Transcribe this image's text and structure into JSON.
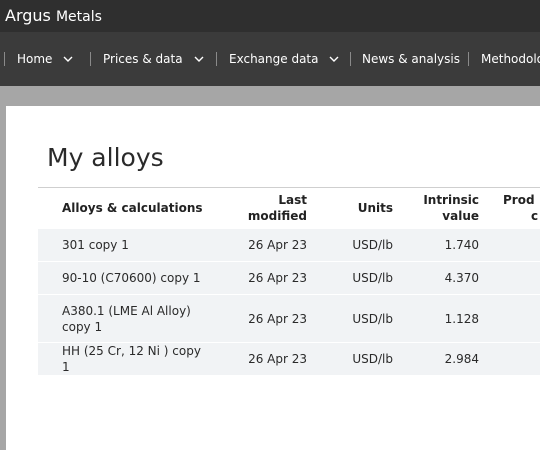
{
  "brand": {
    "part1": "Argus",
    "part2": "Metals"
  },
  "nav": [
    {
      "label": "Home",
      "has_menu": true
    },
    {
      "label": "Prices & data",
      "has_menu": true
    },
    {
      "label": "Exchange data",
      "has_menu": true
    },
    {
      "label": "News & analysis",
      "has_menu": false
    },
    {
      "label": "Methodolog",
      "has_menu": false
    }
  ],
  "page": {
    "title": "My alloys"
  },
  "table": {
    "headers": {
      "name": "Alloys & calculations",
      "modified_line1": "Last",
      "modified_line2": "modified",
      "units": "Units",
      "value_line1": "Intrinsic",
      "value_line2": "value",
      "prod_line1": "Prod",
      "prod_line2": "c"
    },
    "rows": [
      {
        "name": "301 copy 1",
        "modified": "26 Apr 23",
        "units": "USD/lb",
        "value": "1.740"
      },
      {
        "name": "90-10 (C70600) copy 1",
        "modified": "26 Apr 23",
        "units": "USD/lb",
        "value": "4.370"
      },
      {
        "name": "A380.1 (LME Al Alloy) copy 1",
        "modified": "26 Apr 23",
        "units": "USD/lb",
        "value": "1.128"
      },
      {
        "name": "HH (25 Cr, 12 Ni ) copy 1",
        "modified": "26 Apr 23",
        "units": "USD/lb",
        "value": "2.984"
      }
    ]
  }
}
